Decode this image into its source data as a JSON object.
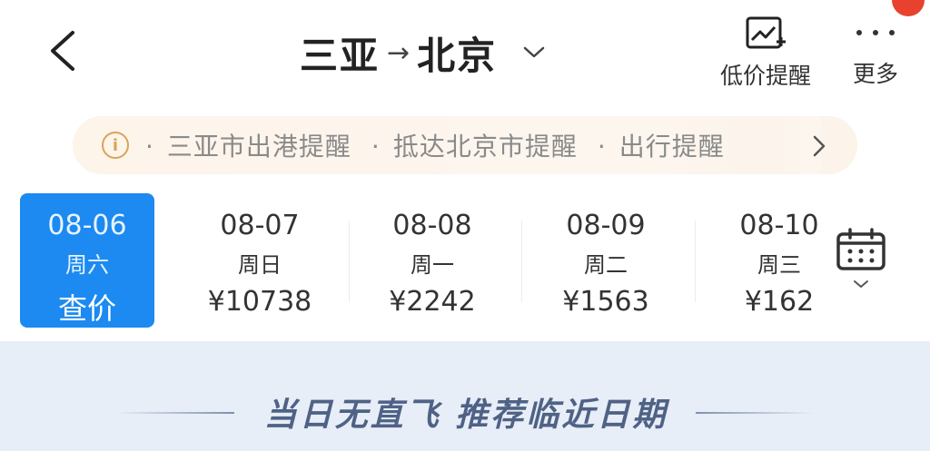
{
  "header": {
    "origin": "三亚",
    "destination": "北京",
    "route_arrow": "→",
    "price_alert_label": "低价提醒",
    "more_label": "更多"
  },
  "notice": {
    "info_icon": "i",
    "items": [
      "三亚市出港提醒",
      "抵达北京市提醒",
      "出行提醒"
    ]
  },
  "dates": [
    {
      "date": "08-06",
      "weekday": "周六",
      "price": "查价",
      "selected": true
    },
    {
      "date": "08-07",
      "weekday": "周日",
      "price": "¥10738",
      "selected": false
    },
    {
      "date": "08-08",
      "weekday": "周一",
      "price": "¥2242",
      "selected": false
    },
    {
      "date": "08-09",
      "weekday": "周二",
      "price": "¥1563",
      "selected": false
    },
    {
      "date": "08-10",
      "weekday": "周三",
      "price": "¥162",
      "selected": false
    }
  ],
  "recommendation": "当日无直飞 推荐临近日期",
  "icons": {
    "back": "chevron-left-icon",
    "route_dropdown": "chevron-down-icon",
    "price_alert": "price-chart-plus-icon",
    "more": "more-dots-icon",
    "notice_info": "info-icon",
    "notice_next": "chevron-right-icon",
    "calendar": "calendar-icon",
    "calendar_expand": "chevron-down-icon"
  },
  "colors": {
    "accent": "#1c8af0",
    "notice_bg": "#fdf4ea",
    "notice_icon": "#d9a45a",
    "badge": "#e8412d",
    "bottom_bg": "#e8eef7",
    "recommend_text": "#4f6286"
  }
}
